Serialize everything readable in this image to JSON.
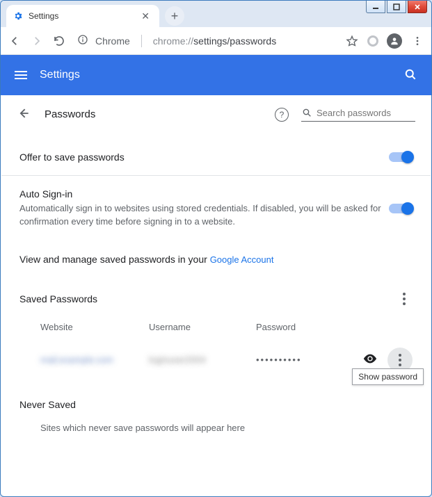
{
  "window": {
    "tab_title": "Settings"
  },
  "omnibox": {
    "chrome_label": "Chrome",
    "url_prefix": "chrome://",
    "url_path": "settings/passwords"
  },
  "settings_bar": {
    "title": "Settings"
  },
  "page": {
    "title": "Passwords",
    "search_placeholder": "Search passwords",
    "offer_label": "Offer to save passwords",
    "autosignin_title": "Auto Sign-in",
    "autosignin_desc": "Automatically sign in to websites using stored credentials. If disabled, you will be asked for confirmation every time before signing in to a website.",
    "manage_text": "View and manage saved passwords in your ",
    "manage_link": "Google Account",
    "saved_title": "Saved Passwords",
    "col_website": "Website",
    "col_username": "Username",
    "col_password": "Password",
    "row_website": "mail.example.com",
    "row_username": "loginuser2004",
    "row_password_mask": "••••••••••",
    "tooltip": "Show password",
    "never_title": "Never Saved",
    "never_text": "Sites which never save passwords will appear here"
  }
}
